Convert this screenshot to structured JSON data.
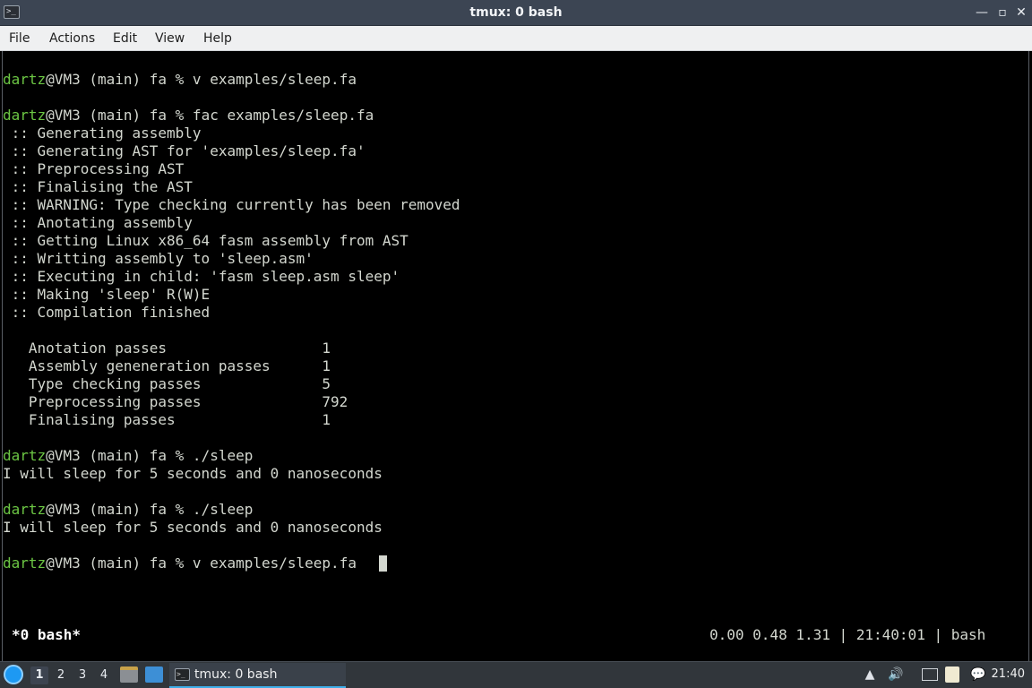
{
  "window": {
    "title": "tmux: 0 bash",
    "app_icon": ">_",
    "buttons": {
      "minimize": "—",
      "restore": "▫",
      "maximize": "□",
      "close": "✕"
    }
  },
  "menu": {
    "items": [
      "File",
      "Actions",
      "Edit",
      "View",
      "Help"
    ]
  },
  "terminal": {
    "user_color": "#6cc644",
    "text_color": "#d3d7cf",
    "lines": [
      {
        "user": "",
        "rest": ""
      },
      {
        "user": "dartz",
        "rest": "@VM3 (main) fa % v examples/sleep.fa"
      },
      {
        "user": "",
        "rest": ""
      },
      {
        "user": "dartz",
        "rest": "@VM3 (main) fa % fac examples/sleep.fa"
      },
      {
        "user": "",
        "rest": " :: Generating assembly"
      },
      {
        "user": "",
        "rest": " :: Generating AST for 'examples/sleep.fa'"
      },
      {
        "user": "",
        "rest": " :: Preprocessing AST"
      },
      {
        "user": "",
        "rest": " :: Finalising the AST"
      },
      {
        "user": "",
        "rest": " :: WARNING: Type checking currently has been removed"
      },
      {
        "user": "",
        "rest": " :: Anotating assembly"
      },
      {
        "user": "",
        "rest": " :: Getting Linux x86_64 fasm assembly from AST"
      },
      {
        "user": "",
        "rest": " :: Writting assembly to 'sleep.asm'"
      },
      {
        "user": "",
        "rest": " :: Executing in child: 'fasm sleep.asm sleep'"
      },
      {
        "user": "",
        "rest": " :: Making 'sleep' R(W)E"
      },
      {
        "user": "",
        "rest": " :: Compilation finished"
      },
      {
        "user": "",
        "rest": ""
      },
      {
        "user": "",
        "rest": "   Anotation passes                  1"
      },
      {
        "user": "",
        "rest": "   Assembly geneneration passes      1"
      },
      {
        "user": "",
        "rest": "   Type checking passes              5"
      },
      {
        "user": "",
        "rest": "   Preprocessing passes              792"
      },
      {
        "user": "",
        "rest": "   Finalising passes                 1"
      },
      {
        "user": "",
        "rest": ""
      },
      {
        "user": "dartz",
        "rest": "@VM3 (main) fa % ./sleep"
      },
      {
        "user": "",
        "rest": "I will sleep for 5 seconds and 0 nanoseconds"
      },
      {
        "user": "",
        "rest": ""
      },
      {
        "user": "dartz",
        "rest": "@VM3 (main) fa % ./sleep"
      },
      {
        "user": "",
        "rest": "I will sleep for 5 seconds and 0 nanoseconds"
      },
      {
        "user": "",
        "rest": ""
      },
      {
        "user": "dartz",
        "rest": "@VM3 (main) fa % v examples/sleep.fa "
      }
    ],
    "status": {
      "left": "*0 bash*",
      "right": "0.00 0.48 1.31 | 21:40:01 | bash"
    }
  },
  "taskbar": {
    "desktops": [
      "1",
      "2",
      "3",
      "4"
    ],
    "active_desktop": "1",
    "task": {
      "icon": ">_",
      "label": "tmux: 0 bash"
    },
    "tray_icons": [
      "battery-icon",
      "volume-icon",
      "network-icon",
      "clipboard-icon",
      "notification-icon"
    ],
    "clock": "21:40",
    "accent": "#3daee9"
  }
}
